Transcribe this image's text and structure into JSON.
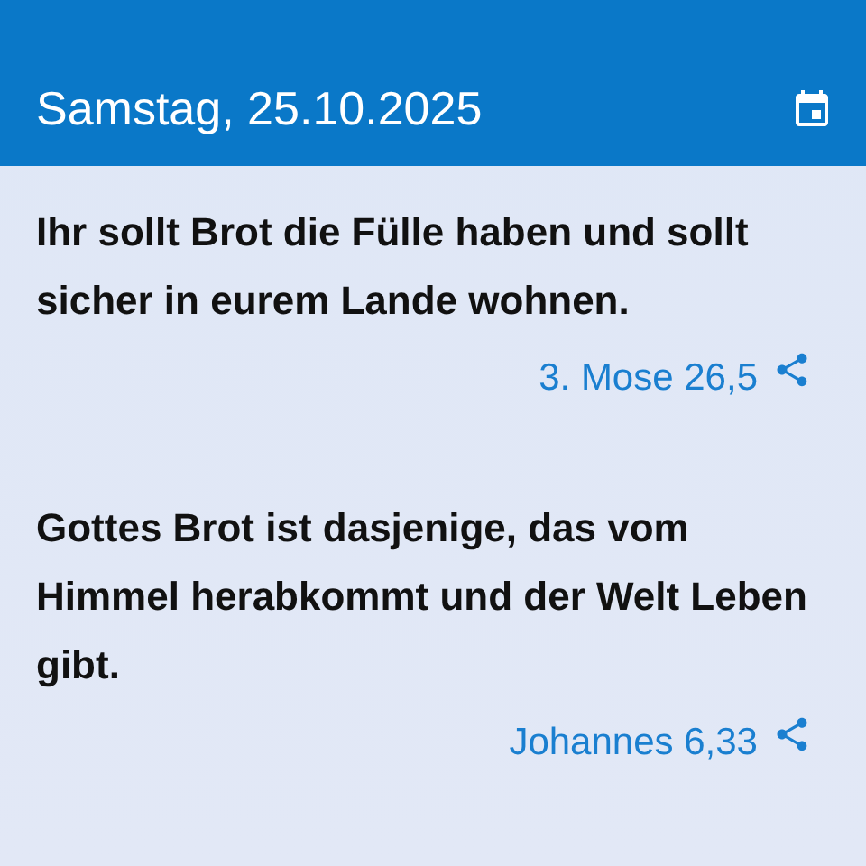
{
  "header": {
    "title": "Samstag, 25.10.2025"
  },
  "verses": [
    {
      "text": "Ihr sollt Brot die Fülle haben und sollt sicher in eurem Lande wohnen.",
      "reference": "3. Mose 26,5"
    },
    {
      "text": "Gottes Brot ist dasjenige, das vom Himmel herabkommt und der Welt Leben gibt.",
      "reference": "Johannes 6,33"
    }
  ]
}
